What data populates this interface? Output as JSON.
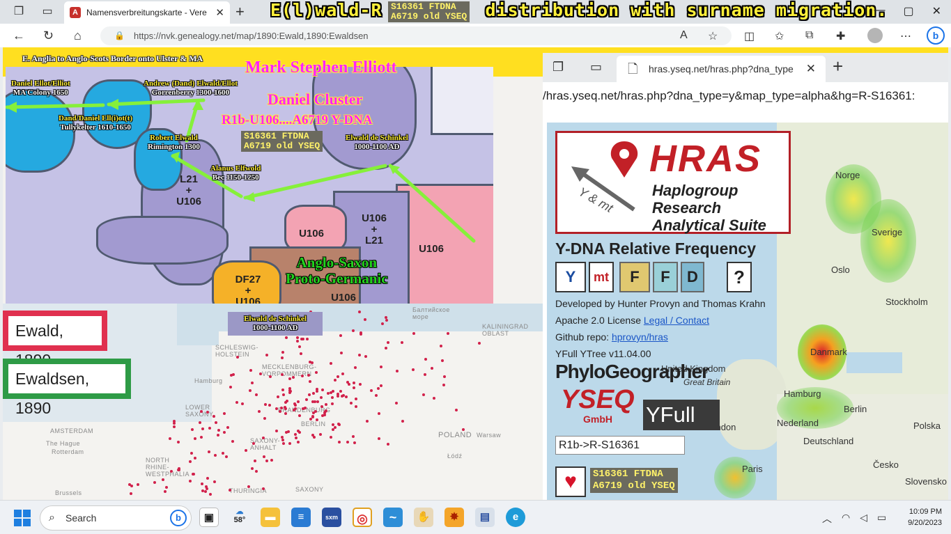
{
  "browser": {
    "tab_title": "Namensverbreitungskarte - Vere",
    "url": "https://nvk.genealogy.net/map/1890:Ewald,1890:Ewaldsen"
  },
  "headline": {
    "left": "E(l)wald-R",
    "right": "distribution with surname migration."
  },
  "snp_badge": "S16361 FTDNA\nA6719 old YSEQ",
  "legend": [
    {
      "label": "Ewald, 1890",
      "color": "#e0304f"
    },
    {
      "label": "Ewaldsen, 1890",
      "color": "#2e9b46"
    }
  ],
  "comic_map": {
    "top_banner": "E. Anglia to Anglo-Scots Border onto Ulster & MA",
    "author": "Mark Stephen Elliott",
    "cluster": "Daniel Cluster",
    "lineage": "R1b-U106....A6719 Y-DNA",
    "regions": {
      "l21_u106": "L21\n+\nU106",
      "u106_a": "U106",
      "u106_l21": "U106\n+\nL21",
      "u106_b": "U106",
      "df27": "DF27\n+\nU106",
      "u106_c": "U106"
    },
    "people": [
      {
        "name": "Daniel Ellot/Elliot",
        "place": "MA Colony 1650"
      },
      {
        "name": "Andrew (Dand) Elwald/Ellot",
        "place": "Gorrenberry 1300-1600"
      },
      {
        "name": "Dand/Daniel Ell(i)ot(t)",
        "place": "Tullykelter 1610-1650"
      },
      {
        "name": "Robert Elwald",
        "place": "Rimington 1300"
      },
      {
        "name": "Elwald de Schinkel",
        "place": "1000-1100 AD"
      },
      {
        "name": "Alanus Elfwold",
        "place": "Bec 1150-1250"
      }
    ],
    "origin": "Anglo-Saxon\nProto-Germanic"
  },
  "elwald_box": {
    "name": "Elwald de Schinkel",
    "place": "1000-1100 AD"
  },
  "basemap_labels": {
    "schleswig": "SCHLESWIG-\nHOLSTEIN",
    "hamburg": "Hamburg",
    "meck": "MECKLENBURG-\nVORPOMMERN",
    "lowersax": "LOWER\nSAXONY",
    "brandenburg": "BRANDENBURG",
    "berlin": "BERLIN",
    "saxanh": "SAXONY-\nANHALT",
    "poland": "POLAND",
    "warsaw": "Warsaw",
    "lodz": "Łódź",
    "amsterdam": "AMSTERDAM",
    "thehague": "The Hague",
    "rotterdam": "Rotterdam",
    "nrw": "NORTH\nRHINE-\nWESTPHALIA",
    "brussels": "Brussels",
    "saxony": "SAXONY",
    "thuringia": "THURINGIA",
    "kaliningrad": "KALININGRAD\nOBLAST",
    "baltic": "Балтийское\nморе"
  },
  "inner_browser": {
    "tab_title": "hras.yseq.net/hras.php?dna_type",
    "url": "/hras.yseq.net/hras.php?dna_type=y&map_type=alpha&hg=R-S16361:"
  },
  "hras": {
    "logo": "HRAS",
    "subtitle": "Haplogroup\nResearch\nAnalytical Suite",
    "ymt": "Y & mt",
    "title": "Y-DNA Relative Frequency",
    "buttons": [
      "Y",
      "mt",
      "F",
      "F",
      "D",
      "?"
    ],
    "developed": "Developed by Hunter Provyn and Thomas Krahn",
    "license_prefix": "Apache 2.0 License",
    "license_link": "Legal / Contact",
    "github_prefix": "Github repo:",
    "github_link": "hprovyn/hras",
    "ytree": "YFull YTree v11.04.00",
    "phylo": "PhyloGeographer",
    "yseq": "YSEQ",
    "gmbh": "GmbH",
    "yfull": "YFull",
    "search_value": "R1b->R-S16361",
    "heart_badge": "S16361 FTDNA\nA6719 old YSEQ",
    "cities": {
      "norge": "Norge",
      "sverige": "Sverige",
      "oslo": "Oslo",
      "stockholm": "Stockholm",
      "danmark": "Danmark",
      "uk": "United Kingdom",
      "gb": "Great Britain",
      "hamburg": "Hamburg",
      "berlin": "Berlin",
      "nederland": "Nederland",
      "london": "London",
      "polska": "Polska",
      "deutschland": "Deutschland",
      "paris": "Paris",
      "cesko": "Česko",
      "slovensko": "Slovensko"
    }
  },
  "taskbar": {
    "search": "Search",
    "weather": "58°",
    "time": "10:09 PM",
    "date": "9/20/2023"
  }
}
